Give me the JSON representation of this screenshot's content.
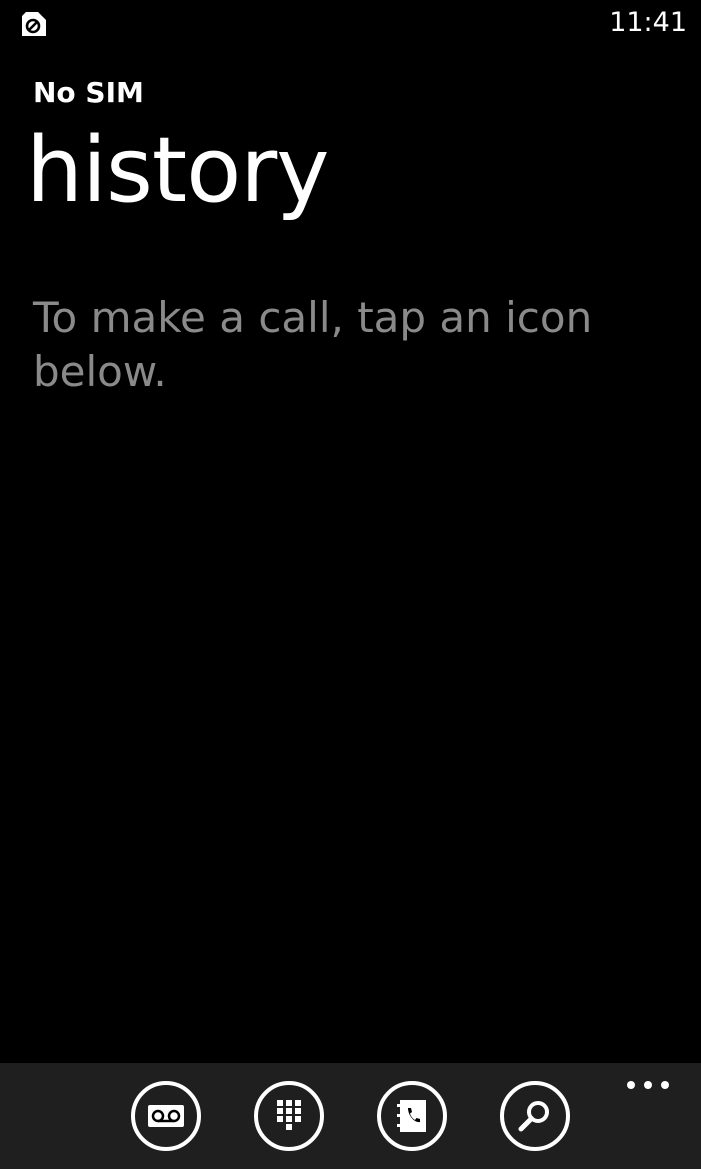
{
  "status_bar": {
    "time": "11:41",
    "sim_icon": "no-sim-icon"
  },
  "header": {
    "app_title": "No SIM",
    "page_title": "history"
  },
  "main": {
    "empty_message": "To make a call, tap an icon below."
  },
  "app_bar": {
    "buttons": [
      {
        "icon": "voicemail-icon"
      },
      {
        "icon": "keypad-icon"
      },
      {
        "icon": "contacts-phonebook-icon"
      },
      {
        "icon": "search-icon"
      }
    ],
    "more_icon": "ellipsis-icon"
  },
  "colors": {
    "background": "#000000",
    "text": "#ffffff",
    "secondary_text": "#8a8a8a",
    "app_bar": "#1f1f1f"
  }
}
